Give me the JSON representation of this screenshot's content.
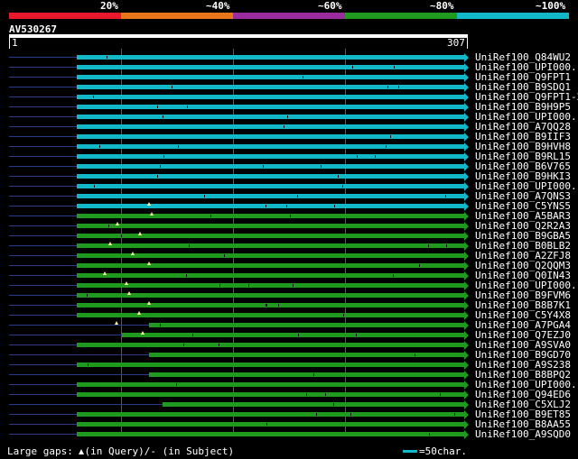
{
  "legend": [
    {
      "label": "20%",
      "color": "#e8192c"
    },
    {
      "label": "~40%",
      "color": "#e8761b"
    },
    {
      "label": "~60%",
      "color": "#9b2ca0"
    },
    {
      "label": "~80%",
      "color": "#1f9a1f"
    },
    {
      "label": "~100%",
      "color": "#12b8c8"
    }
  ],
  "query": {
    "id": "AV530267",
    "start": "1",
    "end": "307"
  },
  "hits": [
    {
      "name": "UniRef100_Q84WU2",
      "band": "~100%",
      "start": 85,
      "ext": 0
    },
    {
      "name": "UniRef100_UPI000..",
      "band": "~100%",
      "start": 85,
      "ext": 0
    },
    {
      "name": "UniRef100_Q9FPT1",
      "band": "~100%",
      "start": 85,
      "ext": 0
    },
    {
      "name": "UniRef100_B9SDQ1",
      "band": "~100%",
      "start": 85,
      "ext": 0
    },
    {
      "name": "UniRef100_Q9FPT1-2",
      "band": "~100%",
      "start": 85,
      "ext": 0
    },
    {
      "name": "UniRef100_B9H9P5",
      "band": "~100%",
      "start": 85,
      "ext": 0
    },
    {
      "name": "UniRef100_UPI000..",
      "band": "~100%",
      "start": 85,
      "ext": 0
    },
    {
      "name": "UniRef100_A7QQ28",
      "band": "~100%",
      "start": 85,
      "ext": 0
    },
    {
      "name": "UniRef100_B9IIF3",
      "band": "~100%",
      "start": 85,
      "ext": 0
    },
    {
      "name": "UniRef100_B9HVH8",
      "band": "~100%",
      "start": 85,
      "ext": 0
    },
    {
      "name": "UniRef100_B9RL15",
      "band": "~100%",
      "start": 85,
      "ext": 0
    },
    {
      "name": "UniRef100_B6V765",
      "band": "~100%",
      "start": 85,
      "ext": 0
    },
    {
      "name": "UniRef100_B9HKI3",
      "band": "~100%",
      "start": 85,
      "ext": 0
    },
    {
      "name": "UniRef100_UPI000..",
      "band": "~100%",
      "start": 85,
      "ext": 0
    },
    {
      "name": "UniRef100_A7QNS3",
      "band": "~100%",
      "start": 85,
      "ext": 0
    },
    {
      "name": "UniRef100_C5YNS5",
      "band": "~100%",
      "start": 85,
      "ext": 0
    },
    {
      "name": "UniRef100_A5BAR3",
      "band": "~80%",
      "start": 85,
      "ext": 0
    },
    {
      "name": "UniRef100_Q2R2A3",
      "band": "~80%",
      "start": 85,
      "ext": 0
    },
    {
      "name": "UniRef100_B9GBA5",
      "band": "~80%",
      "start": 85,
      "ext": 0
    },
    {
      "name": "UniRef100_B0BLB2",
      "band": "~80%",
      "start": 85,
      "ext": 0
    },
    {
      "name": "UniRef100_A2ZFJ8",
      "band": "~80%",
      "start": 85,
      "ext": 0
    },
    {
      "name": "UniRef100_Q2QQM3",
      "band": "~80%",
      "start": 85,
      "ext": 0
    },
    {
      "name": "UniRef100_Q0IN43",
      "band": "~80%",
      "start": 85,
      "ext": 0
    },
    {
      "name": "UniRef100_UPI000..",
      "band": "~80%",
      "start": 85,
      "ext": 0
    },
    {
      "name": "UniRef100_B9FVM6",
      "band": "~80%",
      "start": 85,
      "ext": 0
    },
    {
      "name": "UniRef100_B8B7K1",
      "band": "~80%",
      "start": 85,
      "ext": 0
    },
    {
      "name": "UniRef100_C5Y4X8",
      "band": "~80%",
      "start": 85,
      "ext": 0
    },
    {
      "name": "UniRef100_A7PGA4",
      "band": "~80%",
      "start": 165,
      "ext": 0
    },
    {
      "name": "UniRef100_Q7EZJ0",
      "band": "~80%",
      "start": 135,
      "ext": 0
    },
    {
      "name": "UniRef100_A9SVA0",
      "band": "~80%",
      "start": 85,
      "ext": 0
    },
    {
      "name": "UniRef100_B9GD70",
      "band": "~80%",
      "start": 165,
      "ext": 0
    },
    {
      "name": "UniRef100_A9S238",
      "band": "~80%",
      "start": 85,
      "ext": 0
    },
    {
      "name": "UniRef100_B8BPQ2",
      "band": "~80%",
      "start": 165,
      "ext": 0
    },
    {
      "name": "UniRef100_UPI000..",
      "band": "~80%",
      "start": 85,
      "ext": 0
    },
    {
      "name": "UniRef100_Q94ED6",
      "band": "~80%",
      "start": 85,
      "ext": 0
    },
    {
      "name": "UniRef100_C5XLJ2",
      "band": "~80%",
      "start": 180,
      "ext": 0
    },
    {
      "name": "UniRef100_B9ET85",
      "band": "~80%",
      "start": 85,
      "ext": 0
    },
    {
      "name": "UniRef100_B8AA55",
      "band": "~80%",
      "start": 85,
      "ext": 0
    },
    {
      "name": "UniRef100_A9SQD0",
      "band": "~80%",
      "start": 85,
      "ext": 0
    }
  ],
  "footer": {
    "prefix": "Large gaps: ",
    "in_query": "(in Query)/",
    "dash": "-",
    "in_subject": " (in Subject)",
    "scale_label": "=50char.",
    "scale_color": "#12b8c8"
  }
}
